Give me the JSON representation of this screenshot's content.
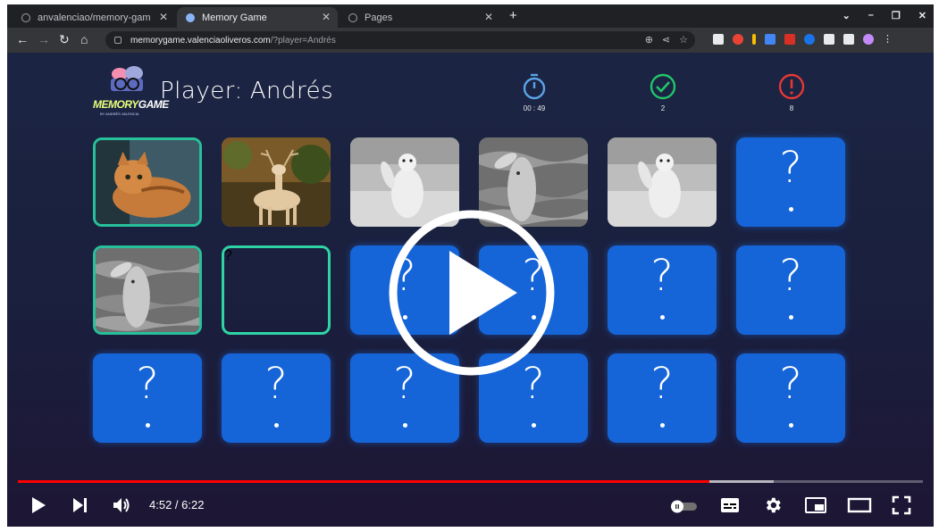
{
  "browser": {
    "tabs": [
      {
        "title": "anvalenciao/memory-gam",
        "active": false
      },
      {
        "title": "Memory Game",
        "active": true
      },
      {
        "title": "Pages",
        "active": false
      }
    ],
    "url_host": "memorygame.valenciaoliveros.com",
    "url_rest": "/?player=Andrés"
  },
  "game": {
    "logo_word_a": "MEMORY",
    "logo_word_b": "GAME",
    "logo_sub": "BY ANDRÉS VALENCIA",
    "player_label": "Player:",
    "player_name": "Andrés",
    "timer_value": "00 : 49",
    "hits_value": "2",
    "errors_value": "8",
    "card_symbol": "?",
    "colors": {
      "accent_blue": "#1565d8",
      "timer": "#5ba3e8",
      "hit": "#22c56b",
      "error": "#e53935",
      "match_border": "#27c09a"
    },
    "cards": [
      {
        "state": "matched",
        "image": "cat-photo"
      },
      {
        "state": "revealed",
        "image": "deer-photo"
      },
      {
        "state": "revealed",
        "image": "polar-bear-photo"
      },
      {
        "state": "revealed",
        "image": "dolphin-photo"
      },
      {
        "state": "revealed",
        "image": "polar-bear-photo"
      },
      {
        "state": "hidden"
      },
      {
        "state": "matched",
        "image": "dolphin-photo"
      },
      {
        "state": "selected"
      },
      {
        "state": "hidden"
      },
      {
        "state": "hidden"
      },
      {
        "state": "hidden"
      },
      {
        "state": "hidden"
      },
      {
        "state": "hidden"
      },
      {
        "state": "hidden"
      },
      {
        "state": "hidden"
      },
      {
        "state": "hidden"
      },
      {
        "state": "hidden"
      },
      {
        "state": "hidden"
      }
    ]
  },
  "video": {
    "current_time": "4:52",
    "duration": "6:22",
    "time_display": "4:52 / 6:22",
    "played_fraction": 0.764,
    "buffered_fraction": 0.835
  }
}
